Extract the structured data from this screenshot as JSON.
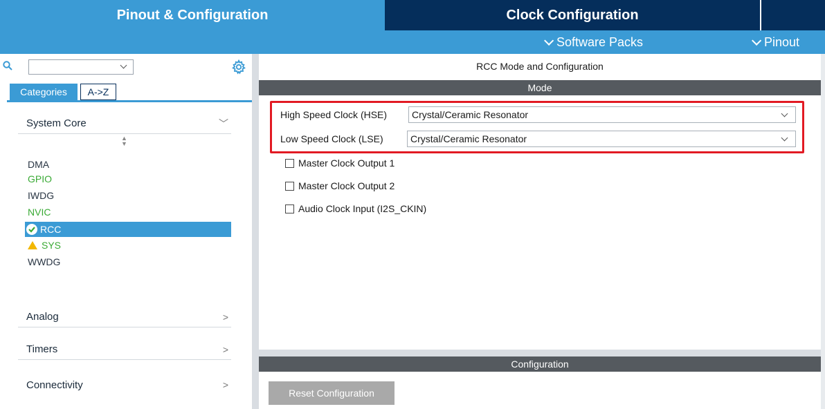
{
  "tabs": {
    "pinout": "Pinout & Configuration",
    "clock": "Clock Configuration"
  },
  "subbar": {
    "software_packs": "Software Packs",
    "pinout": "Pinout"
  },
  "sidebar": {
    "category_tabs": [
      "Categories",
      "A->Z"
    ],
    "sections": {
      "system_core": "System Core",
      "analog": "Analog",
      "timers": "Timers",
      "connectivity": "Connectivity"
    },
    "items": [
      {
        "label": "DMA",
        "color": "#2a3644"
      },
      {
        "label": "GPIO",
        "color": "#3aaa35"
      },
      {
        "label": "IWDG",
        "color": "#2a3644"
      },
      {
        "label": "NVIC",
        "color": "#3aaa35"
      },
      {
        "label": "RCC",
        "selected": true,
        "status_icon": "check-icon"
      },
      {
        "label": "SYS",
        "color": "#3aaa35",
        "status_icon": "warning-icon"
      },
      {
        "label": "WWDG",
        "color": "#2a3644"
      }
    ]
  },
  "main": {
    "title": "RCC Mode and Configuration",
    "mode_header": "Mode",
    "hse_label": "High Speed Clock (HSE)",
    "hse_value": "Crystal/Ceramic Resonator",
    "lse_label": "Low Speed Clock (LSE)",
    "lse_value": "Crystal/Ceramic Resonator",
    "checkboxes": [
      "Master Clock Output 1",
      "Master Clock Output 2",
      "Audio Clock Input (I2S_CKIN)"
    ],
    "config_header": "Configuration",
    "reset_button": "Reset Configuration"
  },
  "colors": {
    "accent": "#3b9bd5",
    "dark_tab": "#052e5b",
    "highlight": "#e21a23",
    "green_item": "#3aaa35"
  }
}
